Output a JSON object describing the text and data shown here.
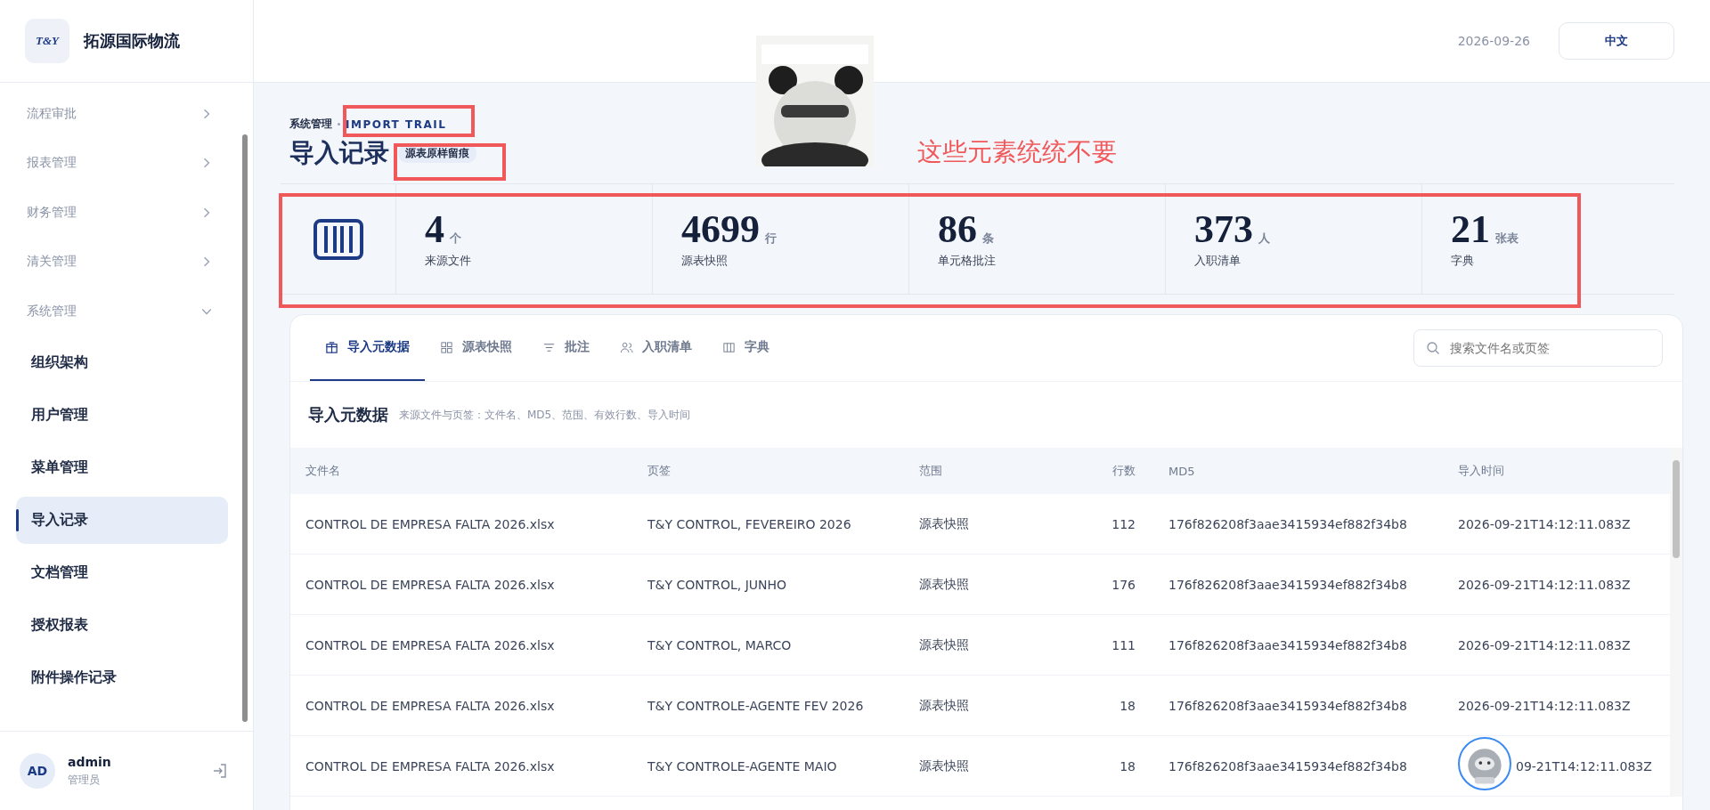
{
  "brand": {
    "name": "拓源国际物流",
    "logo_text": "T&Y"
  },
  "sidebar": {
    "items": [
      {
        "label": "流程审批",
        "expanded": false
      },
      {
        "label": "报表管理",
        "expanded": false
      },
      {
        "label": "财务管理",
        "expanded": false
      },
      {
        "label": "清关管理",
        "expanded": false
      },
      {
        "label": "系统管理",
        "expanded": true,
        "children": [
          {
            "label": "组织架构",
            "selected": false
          },
          {
            "label": "用户管理",
            "selected": false
          },
          {
            "label": "菜单管理",
            "selected": false
          },
          {
            "label": "导入记录",
            "selected": true
          },
          {
            "label": "文档管理",
            "selected": false
          },
          {
            "label": "授权报表",
            "selected": false
          },
          {
            "label": "附件操作记录",
            "selected": false
          }
        ]
      }
    ]
  },
  "user": {
    "initials": "AD",
    "name": "admin",
    "role": "管理员"
  },
  "header": {
    "date": "2026-09-26",
    "language": "中文"
  },
  "breadcrumb": [
    "系统管理",
    "IMPORT TRAIL"
  ],
  "page": {
    "title": "导入记录",
    "tag": "源表原样留痕"
  },
  "stats": [
    {
      "value": "4",
      "unit": "个",
      "label": "来源文件"
    },
    {
      "value": "4699",
      "unit": "行",
      "label": "源表快照"
    },
    {
      "value": "86",
      "unit": "条",
      "label": "单元格批注"
    },
    {
      "value": "373",
      "unit": "人",
      "label": "入职清单"
    },
    {
      "value": "21",
      "unit": "张表",
      "label": "字典"
    }
  ],
  "tabs": [
    {
      "label": "导入元数据",
      "selected": true
    },
    {
      "label": "源表快照",
      "selected": false
    },
    {
      "label": "批注",
      "selected": false
    },
    {
      "label": "入职清单",
      "selected": false
    },
    {
      "label": "字典",
      "selected": false
    }
  ],
  "search": {
    "placeholder": "搜索文件名或页签"
  },
  "section": {
    "title": "导入元数据",
    "subtitle": "来源文件与页签：文件名、MD5、范围、有效行数、导入时间"
  },
  "table": {
    "columns": [
      "文件名",
      "页签",
      "范围",
      "行数",
      "MD5",
      "导入时间"
    ],
    "rows": [
      [
        "CONTROL DE EMPRESA FALTA 2026.xlsx",
        "T&Y CONTROL, FEVEREIRO 2026",
        "源表快照",
        "112",
        "176f826208f3aae3415934ef882f34b8",
        "2026-09-21T14:12:11.083Z"
      ],
      [
        "CONTROL DE EMPRESA FALTA 2026.xlsx",
        "T&Y CONTROL, JUNHO",
        "源表快照",
        "176",
        "176f826208f3aae3415934ef882f34b8",
        "2026-09-21T14:12:11.083Z"
      ],
      [
        "CONTROL DE EMPRESA FALTA 2026.xlsx",
        "T&Y CONTROL, MARCO",
        "源表快照",
        "111",
        "176f826208f3aae3415934ef882f34b8",
        "2026-09-21T14:12:11.083Z"
      ],
      [
        "CONTROL DE EMPRESA FALTA 2026.xlsx",
        "T&Y CONTROLE-AGENTE FEV 2026",
        "源表快照",
        "18",
        "176f826208f3aae3415934ef882f34b8",
        "2026-09-21T14:12:11.083Z"
      ],
      [
        "CONTROL DE EMPRESA FALTA 2026.xlsx",
        "T&Y CONTROLE-AGENTE MAIO",
        "源表快照",
        "18",
        "176f826208f3aae3415934ef882f34b8",
        "09-21T14:12:11.083Z"
      ]
    ]
  },
  "annotation": {
    "note": "这些元素统统不要"
  }
}
